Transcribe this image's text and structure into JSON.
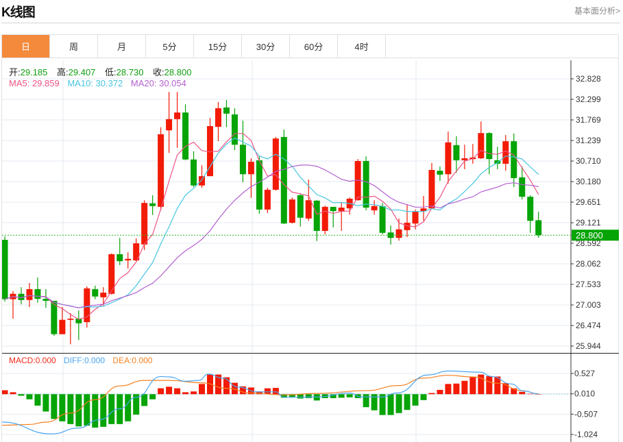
{
  "header": {
    "title": "K线图",
    "link": "基本面分析>"
  },
  "tabs": [
    "日",
    "周",
    "月",
    "5分",
    "15分",
    "30分",
    "60分",
    "4时"
  ],
  "active_tab": 0,
  "ohlc": {
    "open_label": "开:",
    "open": "29.185",
    "high_label": "高:",
    "high": "29.407",
    "low_label": "低:",
    "low": "28.730",
    "close_label": "收:",
    "close": "28.800"
  },
  "ma": {
    "ma5": "MA5: 29.859",
    "ma10": "MA10: 30.372",
    "ma20": "MA20: 30.054"
  },
  "macd_legend": {
    "macd": "MACD:0.000",
    "diff": "DIFF:0.000",
    "dea": "DEA:0.000"
  },
  "colors": {
    "up": "#f21b06",
    "down": "#06a406",
    "ma5": "#ee5585",
    "ma10": "#46c6df",
    "ma20": "#b35fd0",
    "diff": "#4aa5f2",
    "dea": "#f5801f",
    "tab_active": "#f38a3c"
  },
  "chart_data": {
    "type": "candlestick",
    "current_price": "28.800",
    "price_ticks": [
      "32.828",
      "32.299",
      "31.769",
      "31.239",
      "30.710",
      "30.180",
      "29.651",
      "29.121",
      "28.592",
      "28.062",
      "27.533",
      "27.003",
      "26.474",
      "25.944"
    ],
    "price_range": [
      25.944,
      32.828
    ],
    "macd_ticks": [
      "0.527",
      "0.010",
      "-0.507",
      "-1.024"
    ],
    "macd_range": [
      -1.024,
      0.527
    ],
    "candles": [
      [
        28.68,
        27.15,
        28.77,
        27.09
      ],
      [
        27.15,
        27.29,
        27.36,
        26.65
      ],
      [
        27.29,
        27.13,
        27.46,
        27.02
      ],
      [
        27.13,
        27.41,
        27.57,
        26.95
      ],
      [
        27.41,
        27.16,
        27.71,
        27.06
      ],
      [
        27.16,
        27.11,
        27.41,
        26.93
      ],
      [
        27.11,
        26.25,
        27.11,
        26.21
      ],
      [
        26.25,
        26.62,
        26.95,
        26.25
      ],
      [
        26.62,
        26.65,
        26.79,
        25.99
      ],
      [
        26.65,
        26.53,
        26.86,
        26.1
      ],
      [
        26.56,
        27.43,
        27.48,
        26.42
      ],
      [
        27.41,
        27.22,
        27.5,
        27.15
      ],
      [
        27.2,
        27.32,
        27.46,
        26.99
      ],
      [
        27.29,
        28.31,
        28.33,
        27.27
      ],
      [
        28.31,
        28.13,
        28.73,
        28.03
      ],
      [
        28.15,
        28.19,
        28.36,
        27.94
      ],
      [
        28.15,
        28.59,
        28.72,
        28.13
      ],
      [
        28.56,
        29.63,
        29.7,
        28.42
      ],
      [
        29.62,
        29.55,
        29.83,
        29.32
      ],
      [
        29.53,
        31.4,
        31.58,
        29.44
      ],
      [
        31.5,
        31.79,
        32.49,
        30.92
      ],
      [
        31.79,
        31.96,
        32.49,
        31.05
      ],
      [
        31.96,
        30.75,
        32.17,
        30.73
      ],
      [
        30.75,
        30.08,
        30.96,
        30.04
      ],
      [
        30.08,
        30.32,
        30.6,
        30.02
      ],
      [
        30.32,
        31.61,
        31.82,
        30.32
      ],
      [
        31.59,
        32.07,
        32.23,
        31.22
      ],
      [
        32.09,
        31.93,
        32.28,
        31.58
      ],
      [
        31.91,
        31.13,
        32.07,
        30.99
      ],
      [
        31.13,
        30.37,
        31.75,
        30.16
      ],
      [
        30.37,
        30.69,
        30.78,
        29.76
      ],
      [
        30.73,
        29.46,
        30.83,
        29.35
      ],
      [
        29.46,
        29.97,
        30.02,
        29.37
      ],
      [
        29.97,
        31.29,
        31.33,
        29.95
      ],
      [
        31.33,
        29.1,
        31.52,
        29.09
      ],
      [
        29.12,
        29.72,
        29.77,
        29.1
      ],
      [
        29.83,
        29.25,
        29.86,
        29.02
      ],
      [
        29.23,
        29.7,
        30.23,
        29.17
      ],
      [
        29.69,
        28.91,
        29.7,
        28.65
      ],
      [
        28.91,
        29.53,
        29.56,
        28.82
      ],
      [
        29.53,
        29.42,
        29.53,
        29.0
      ],
      [
        29.42,
        29.51,
        29.63,
        28.91
      ],
      [
        29.49,
        29.74,
        29.77,
        29.33
      ],
      [
        29.7,
        30.71,
        30.76,
        29.69
      ],
      [
        30.71,
        29.51,
        30.83,
        29.44
      ],
      [
        29.44,
        29.55,
        29.7,
        29.33
      ],
      [
        29.55,
        28.86,
        29.63,
        28.82
      ],
      [
        28.87,
        28.73,
        29.05,
        28.56
      ],
      [
        28.73,
        28.95,
        29.23,
        28.66
      ],
      [
        28.93,
        29.12,
        29.6,
        28.75
      ],
      [
        29.1,
        29.42,
        29.46,
        28.95
      ],
      [
        29.42,
        29.49,
        29.81,
        29.17
      ],
      [
        29.49,
        30.48,
        30.66,
        29.47
      ],
      [
        30.46,
        30.36,
        30.57,
        30.2
      ],
      [
        30.37,
        31.19,
        31.47,
        30.13
      ],
      [
        31.12,
        30.73,
        31.35,
        30.41
      ],
      [
        30.73,
        30.78,
        31.13,
        30.5
      ],
      [
        30.76,
        30.8,
        31.15,
        30.64
      ],
      [
        30.78,
        31.43,
        31.73,
        30.76
      ],
      [
        31.43,
        30.76,
        31.45,
        30.37
      ],
      [
        30.73,
        30.64,
        31.08,
        30.5
      ],
      [
        30.64,
        31.22,
        31.38,
        30.46
      ],
      [
        31.22,
        30.27,
        31.42,
        30.04
      ],
      [
        30.29,
        29.79,
        30.57,
        29.72
      ],
      [
        29.79,
        29.17,
        29.83,
        28.86
      ],
      [
        29.185,
        28.8,
        29.407,
        28.73
      ]
    ],
    "macd_hist": [
      0.1,
      0.05,
      -0.04,
      -0.13,
      -0.29,
      -0.44,
      -0.63,
      -0.69,
      -0.76,
      -0.82,
      -0.8,
      -0.85,
      -0.83,
      -0.76,
      -0.76,
      -0.69,
      -0.52,
      -0.3,
      -0.13,
      0.15,
      0.19,
      0.15,
      0.05,
      0.07,
      0.26,
      0.5,
      0.5,
      0.43,
      0.29,
      0.2,
      0.17,
      0.07,
      0.15,
      0.16,
      -0.09,
      -0.07,
      -0.11,
      -0.1,
      -0.16,
      -0.1,
      -0.1,
      -0.09,
      -0.08,
      -0.1,
      -0.33,
      -0.41,
      -0.53,
      -0.53,
      -0.48,
      -0.4,
      -0.29,
      -0.15,
      0.03,
      0.11,
      0.26,
      0.27,
      0.34,
      0.43,
      0.5,
      0.46,
      0.45,
      0.28,
      0.15,
      0.06,
      0.01,
      0.0
    ],
    "diff": [
      [
        -0.6,
        -0.71
      ],
      [
        5.7,
        -1.01
      ],
      [
        9,
        -0.86
      ],
      [
        11.5,
        -0.65
      ],
      [
        14,
        -0.37
      ],
      [
        16,
        -0.08
      ],
      [
        19,
        0.45
      ],
      [
        20,
        0.44
      ],
      [
        22,
        0.33
      ],
      [
        23.6,
        0.35
      ],
      [
        24.8,
        0.51
      ],
      [
        26.5,
        0.41
      ],
      [
        28.4,
        0.18
      ],
      [
        30.8,
        0.06
      ],
      [
        33,
        0.06
      ],
      [
        34,
        -0.08
      ],
      [
        38,
        -0.07
      ],
      [
        42,
        0.03
      ],
      [
        43.4,
        -0.07
      ],
      [
        46,
        -0.07
      ],
      [
        47.7,
        0.03
      ],
      [
        51.6,
        0.49
      ],
      [
        54,
        0.59
      ],
      [
        57.9,
        0.56
      ],
      [
        59.3,
        0.45
      ],
      [
        61.7,
        0.26
      ],
      [
        63.2,
        0.08
      ],
      [
        65,
        0.01
      ]
    ],
    "dea": [
      [
        -0.6,
        -0.79
      ],
      [
        3,
        -0.77
      ],
      [
        5,
        -0.71
      ],
      [
        8,
        -0.48
      ],
      [
        11,
        -0.14
      ],
      [
        14,
        0.21
      ],
      [
        17,
        0.35
      ],
      [
        20,
        0.35
      ],
      [
        24,
        0.29
      ],
      [
        27,
        0.15
      ],
      [
        30,
        0.03
      ],
      [
        34,
        -0.02
      ],
      [
        38,
        0.02
      ],
      [
        44,
        0.09
      ],
      [
        48,
        0.22
      ],
      [
        51,
        0.41
      ],
      [
        54,
        0.48
      ],
      [
        57,
        0.44
      ],
      [
        60,
        0.28
      ],
      [
        63,
        0.09
      ],
      [
        65,
        0.01
      ]
    ]
  }
}
